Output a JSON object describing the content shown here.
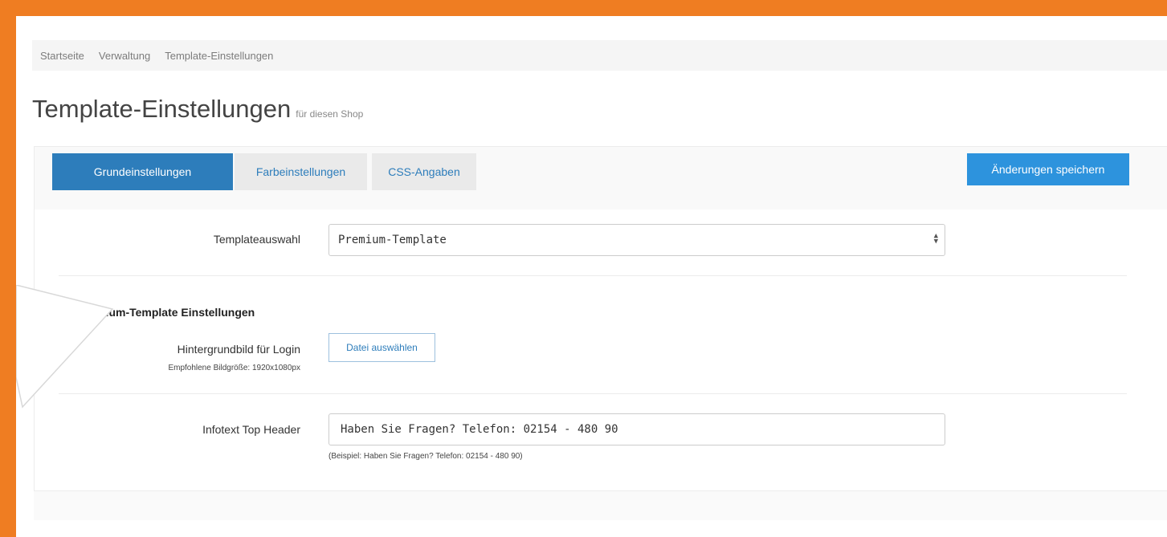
{
  "breadcrumb": [
    "Startseite",
    "Verwaltung",
    "Template-Einstellungen"
  ],
  "page": {
    "title": "Template-Einstellungen",
    "subtitle": "für diesen Shop"
  },
  "tabs": [
    "Grundeinstellungen",
    "Farbeinstellungen",
    "CSS-Angaben"
  ],
  "save_button": "Änderungen speichern",
  "form": {
    "template_label": "Templateauswahl",
    "template_value": "Premium-Template",
    "section_title": "nium-Template Einstellungen",
    "bg_label": "Hintergrundbild für Login",
    "bg_hint": "Empfohlene Bildgröße: 1920x1080px",
    "file_button": "Datei auswählen",
    "infotext_label": "Infotext Top Header",
    "infotext_value": "Haben Sie Fragen? Telefon: 02154 - 480 90",
    "infotext_hint": "(Beispiel: Haben Sie Fragen? Telefon: 02154 - 480 90)"
  },
  "colors": {
    "accent_orange": "#ef7d22",
    "primary_blue": "#2d7dbb",
    "save_blue": "#2d93dd"
  }
}
